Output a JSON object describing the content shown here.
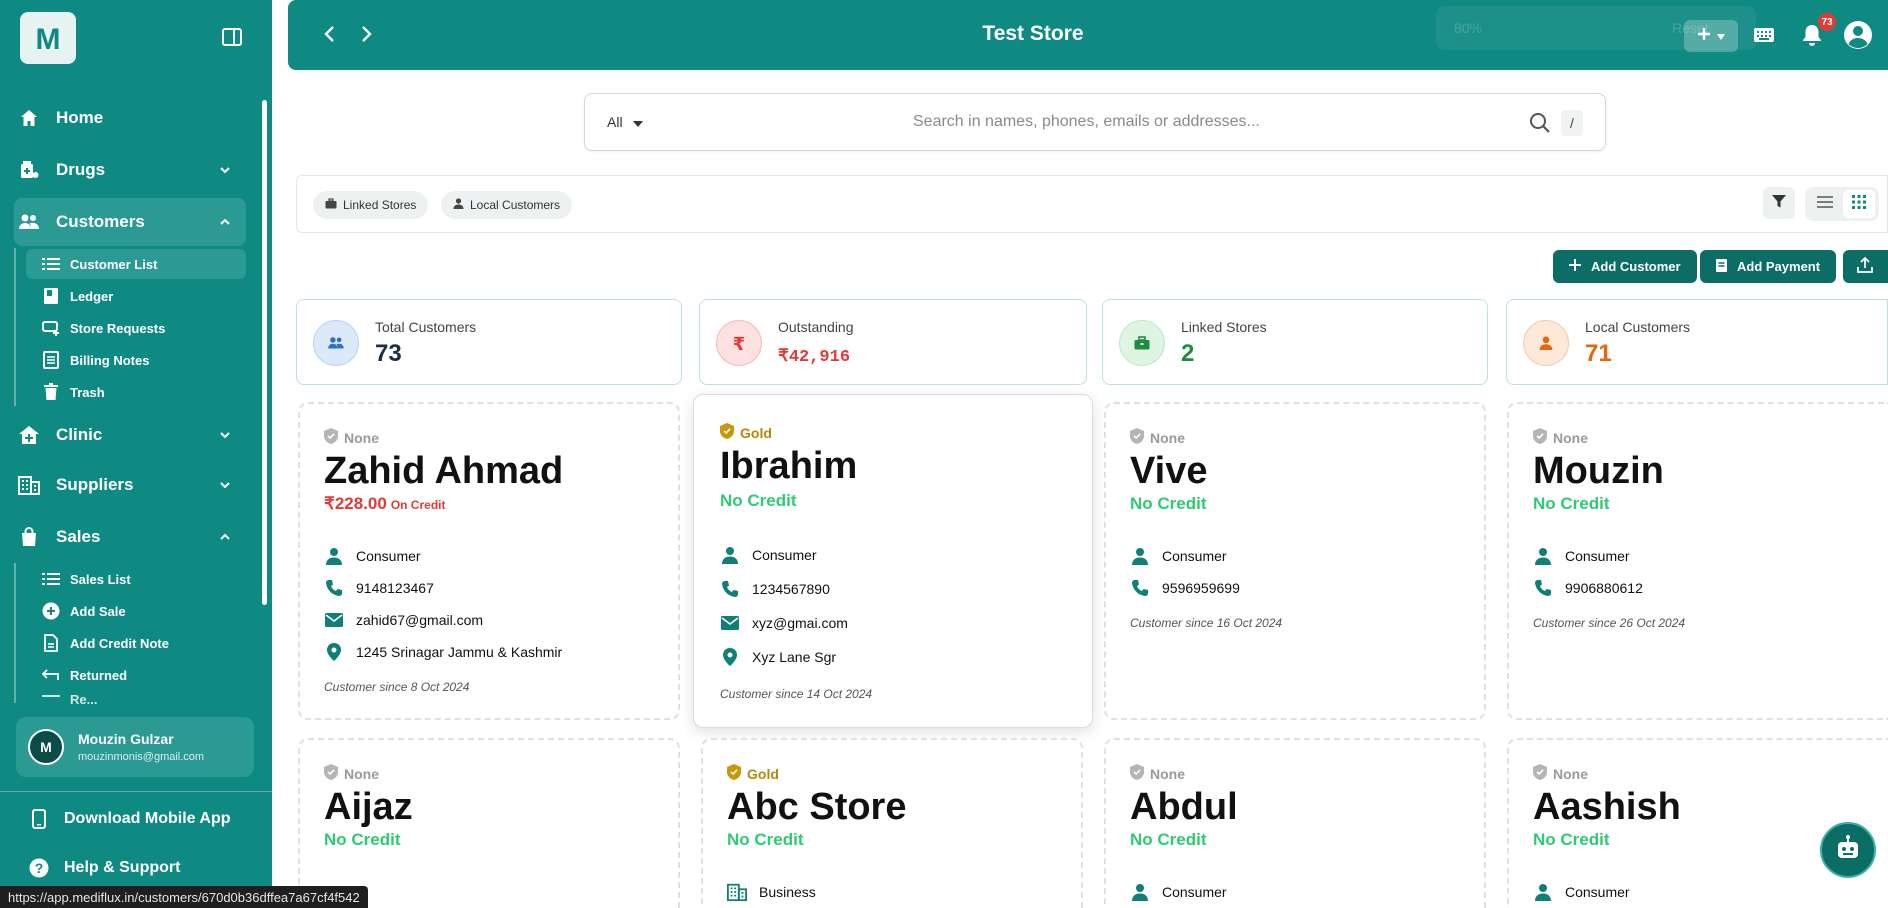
{
  "app": {
    "logo_letter": "M",
    "store_title": "Test Store"
  },
  "topbar": {
    "notification_count": "73",
    "ghost_zoom": "80%",
    "ghost_reset": "Reset"
  },
  "sidebar": {
    "nav": {
      "home": "Home",
      "drugs": "Drugs",
      "customers": "Customers",
      "clinic": "Clinic",
      "suppliers": "Suppliers",
      "sales": "Sales"
    },
    "customers_sub": {
      "customer_list": "Customer List",
      "ledger": "Ledger",
      "store_requests": "Store Requests",
      "billing_notes": "Billing Notes",
      "trash": "Trash"
    },
    "sales_sub": {
      "sales_list": "Sales List",
      "add_sale": "Add Sale",
      "add_credit_note": "Add Credit Note",
      "returned": "Returned",
      "partial": "Re..."
    },
    "user": {
      "initial": "M",
      "name": "Mouzin Gulzar",
      "email": "mouzinmonis@gmail.com"
    },
    "footer": {
      "download": "Download Mobile App",
      "help": "Help & Support"
    }
  },
  "search": {
    "filter_value": "All",
    "placeholder": "Search in names, phones, emails or addresses...",
    "shortcut": "/"
  },
  "chips": {
    "linked": "Linked Stores",
    "local": "Local Customers"
  },
  "actions": {
    "add_customer": "Add Customer",
    "add_payment": "Add Payment"
  },
  "stats": {
    "total": {
      "label": "Total Customers",
      "value": "73"
    },
    "outstanding": {
      "label": "Outstanding",
      "value": "₹42,916"
    },
    "linked": {
      "label": "Linked Stores",
      "value": "2"
    },
    "local": {
      "label": "Local Customers",
      "value": "71"
    }
  },
  "customers": [
    {
      "tier": "None",
      "name": "Zahid Ahmad",
      "credit": "₹228.00",
      "credit_note": "On Credit",
      "type": "Consumer",
      "phone": "9148123467",
      "email": "zahid67@gmail.com",
      "address": "1245 Srinagar Jammu & Kashmir",
      "since": "Customer since 8 Oct 2024"
    },
    {
      "tier": "Gold",
      "name": "Ibrahim",
      "credit": "No Credit",
      "type": "Consumer",
      "phone": "1234567890",
      "email": "xyz@gmai.com",
      "address": "Xyz Lane Sgr",
      "since": "Customer since 14 Oct 2024"
    },
    {
      "tier": "None",
      "name": "Vive",
      "credit": "No Credit",
      "type": "Consumer",
      "phone": "9596959699",
      "since": "Customer since 16 Oct 2024"
    },
    {
      "tier": "None",
      "name": "Mouzin",
      "credit": "No Credit",
      "type": "Consumer",
      "phone": "9906880612",
      "since": "Customer since 26 Oct 2024"
    },
    {
      "tier": "None",
      "name": "Aijaz",
      "credit": "No Credit"
    },
    {
      "tier": "Gold",
      "name": "Abc Store",
      "credit": "No Credit",
      "type": "Business"
    },
    {
      "tier": "None",
      "name": "Abdul",
      "credit": "No Credit",
      "type": "Consumer"
    },
    {
      "tier": "None",
      "name": "Aashish",
      "credit": "No Credit",
      "type": "Consumer"
    }
  ],
  "status_url": "https://app.mediflux.in/customers/670d0b36dffea7a67cf4f542",
  "colors": {
    "brand": "#0f8a83",
    "brand_dark": "#0c6d67",
    "credit_ok": "#2ecc71",
    "credit_owed": "#e53935",
    "gold": "#b8860b"
  }
}
